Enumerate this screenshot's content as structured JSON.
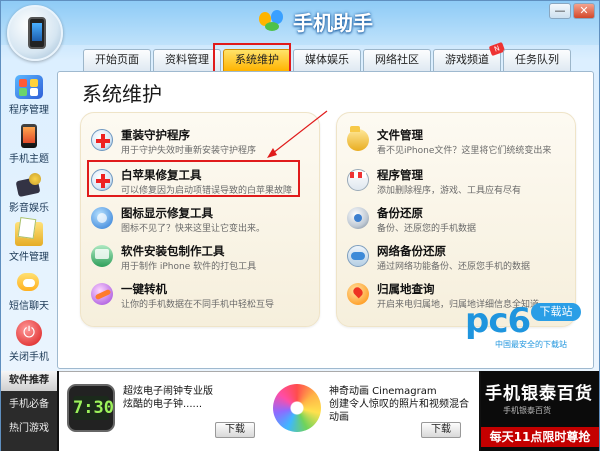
{
  "app": {
    "title": "手机助手"
  },
  "window": {
    "minimize": "—",
    "close": "✕"
  },
  "tabs": [
    {
      "label": "开始页面"
    },
    {
      "label": "资料管理"
    },
    {
      "label": "系统维护"
    },
    {
      "label": "媒体娱乐"
    },
    {
      "label": "网络社区"
    },
    {
      "label": "游戏频道"
    },
    {
      "label": "任务队列"
    }
  ],
  "active_tab": "系统维护",
  "sidebar": [
    {
      "label": "程序管理",
      "icon": "program-icon"
    },
    {
      "label": "手机主题",
      "icon": "theme-icon"
    },
    {
      "label": "影音娱乐",
      "icon": "video-icon"
    },
    {
      "label": "文件管理",
      "icon": "file-icon"
    },
    {
      "label": "短信聊天",
      "icon": "sms-icon"
    },
    {
      "label": "关闭手机",
      "icon": "power-icon"
    }
  ],
  "main": {
    "title": "系统维护",
    "left": [
      {
        "title": "重装守护程序",
        "desc": "用于守护失效时重新安装守护程序",
        "icon": "medical-cross-icon"
      },
      {
        "title": "白苹果修复工具",
        "desc": "可以修复因为启动项错误导致的白苹果故障",
        "icon": "medical-cross-icon"
      },
      {
        "title": "图标显示修复工具",
        "desc": "图标不见了？快来这里让它变出来。",
        "icon": "refresh-icon"
      },
      {
        "title": "软件安装包制作工具",
        "desc": "用于制作 iPhone 软件的打包工具",
        "icon": "package-icon"
      },
      {
        "title": "一键转机",
        "desc": "让你的手机数据在不同手机中轻松互导",
        "icon": "transfer-icon"
      }
    ],
    "right": [
      {
        "title": "文件管理",
        "desc": "看不见iPhone文件？这里将它们统统变出来",
        "icon": "folder-icon"
      },
      {
        "title": "程序管理",
        "desc": "添加删除程序，游戏、工具应有尽有",
        "icon": "store-icon"
      },
      {
        "title": "备份还原",
        "desc": "备份、还原您的手机数据",
        "icon": "disk-icon"
      },
      {
        "title": "网络备份还原",
        "desc": "通过网络功能备份、还原您手机的数据",
        "icon": "cloud-icon"
      },
      {
        "title": "归属地查询",
        "desc": "开启来电归属地，归属地详细信息全知道",
        "icon": "location-icon"
      }
    ]
  },
  "watermark": {
    "logo": "pc6",
    "badge": "下载站",
    "sub": "中国最安全的下载站"
  },
  "bottom": {
    "side": [
      {
        "label": "软件推荐"
      },
      {
        "label": "手机必备"
      },
      {
        "label": "热门游戏"
      }
    ],
    "apps": [
      {
        "name": "超炫电子闹钟专业版",
        "desc": "炫酷的电子钟......",
        "download": "下载",
        "clock_text": "7:30"
      },
      {
        "name": "神奇动画 Cinemagram",
        "desc": "创建令人惊叹的照片和视频混合动画",
        "download": "下载"
      }
    ],
    "ad": {
      "line1": "手机银泰百货",
      "line2": "手机银泰百货",
      "line3": "每天11点限时尊抢"
    }
  }
}
